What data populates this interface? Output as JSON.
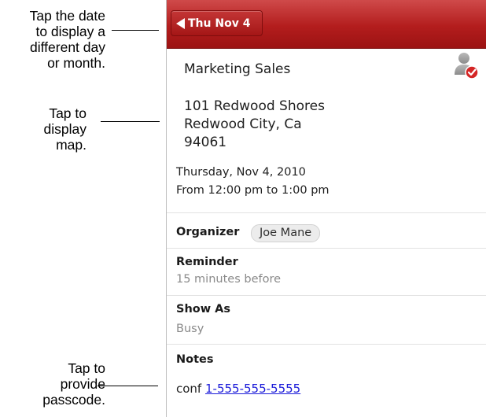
{
  "callouts": [
    {
      "text": "Tap the date\nto display a\ndifferent day\nor month."
    },
    {
      "text": "Tap to\ndisplay\nmap."
    },
    {
      "text": "Tap to\nprovide\npasscode."
    }
  ],
  "header": {
    "date_button_label": "Thu Nov 4",
    "accent_color": "#b31d1d"
  },
  "event": {
    "subject": "Marketing Sales",
    "attendee_icon": "attendee-accepted-icon",
    "address_lines": [
      "101 Redwood Shores",
      "Redwood City, Ca",
      "94061"
    ],
    "date": "Thursday, Nov 4, 2010",
    "time": "From 12:00 pm to 1:00 pm"
  },
  "organizer": {
    "label": "Organizer",
    "name": "Joe Mane"
  },
  "reminder": {
    "label": "Reminder",
    "value": "15 minutes before"
  },
  "show_as": {
    "label": "Show As",
    "value": "Busy"
  },
  "notes": {
    "label": "Notes",
    "prefix": "conf",
    "phone": "1-555-555-5555",
    "link_color": "#1a1ad9"
  }
}
